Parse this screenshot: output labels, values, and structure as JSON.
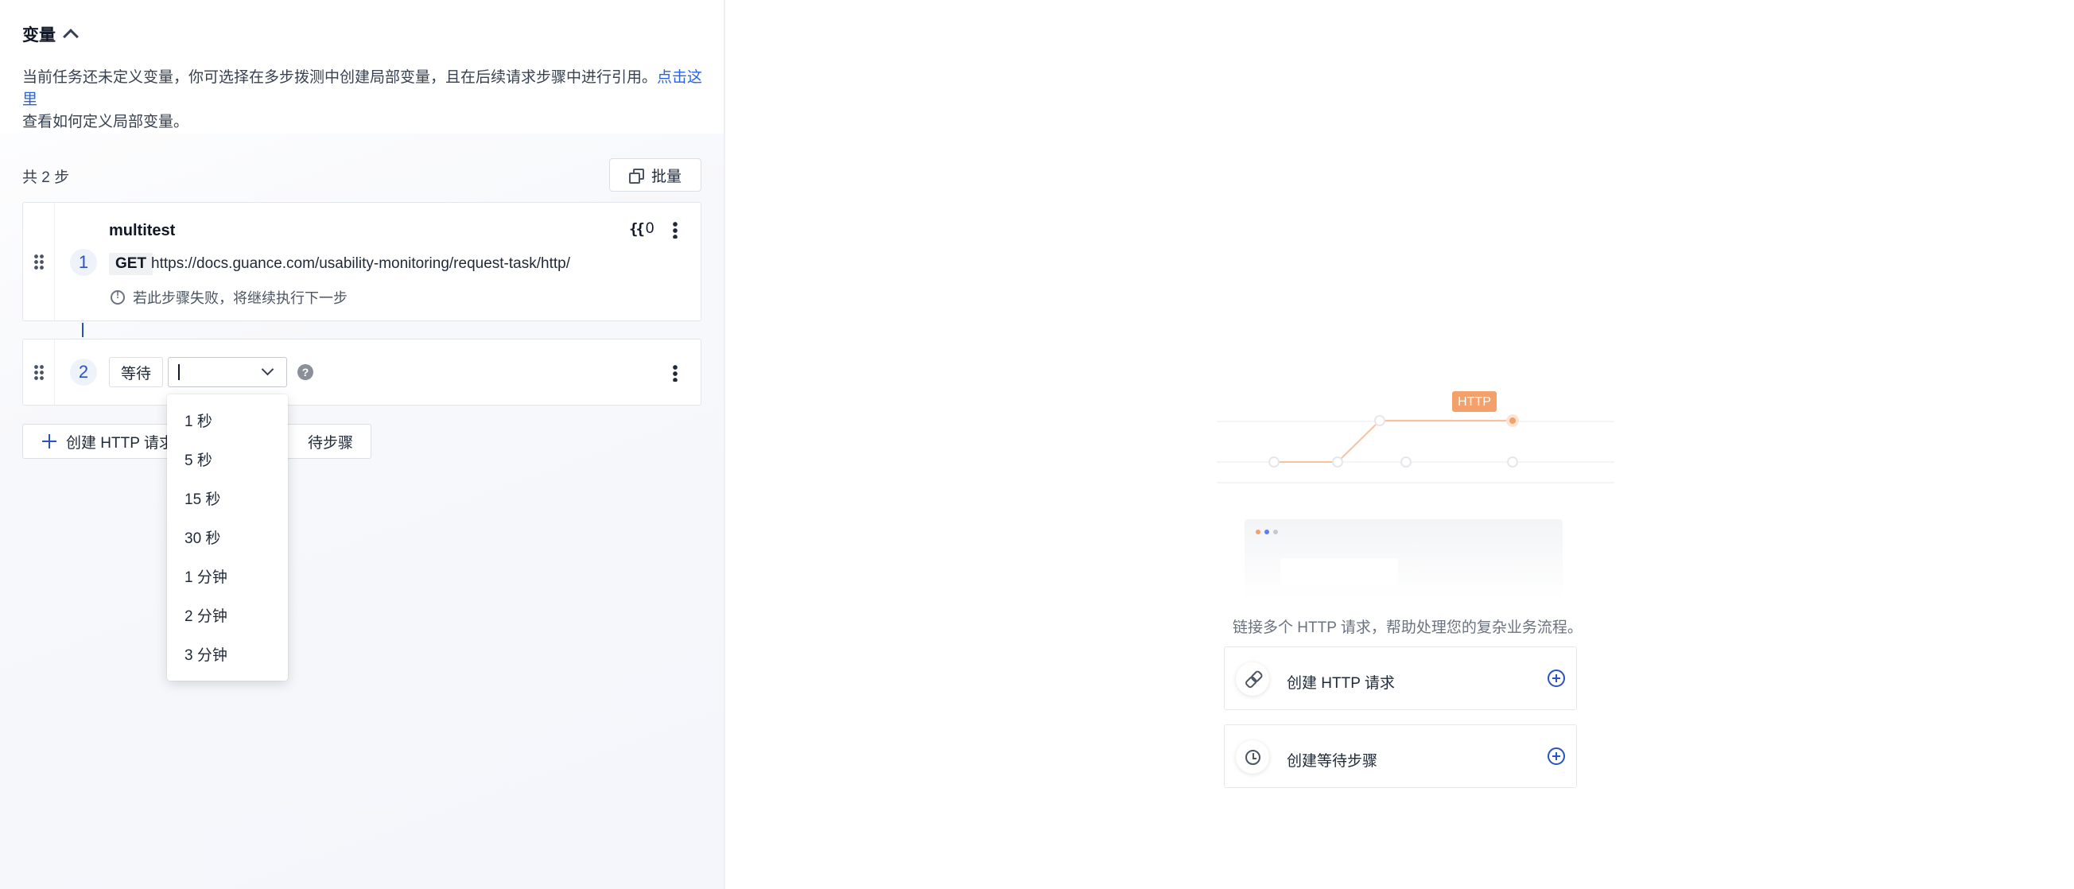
{
  "variables": {
    "title": "变量",
    "description_prefix": "当前任务还未定义变量，你可选择在多步拨测中创建局部变量，且在后续请求步骤中进行引用。",
    "link_text": "点击这里",
    "description_suffix": "查看如何定义局部变量。"
  },
  "steps": {
    "count_label": "共 2 步",
    "batch_label": "批量",
    "step1": {
      "number": "1",
      "name": "multitest",
      "variable_count": "0",
      "method": "GET",
      "url": "https://docs.guance.com/usability-monitoring/request-task/http/",
      "failure_hint": "若此步骤失败，将继续执行下一步"
    },
    "step2": {
      "number": "2",
      "type_label": "等待",
      "selected_value": ""
    },
    "add_http_label": "创建 HTTP 请求",
    "add_wait_label": "待步骤"
  },
  "wait_options": [
    "1 秒",
    "5 秒",
    "15 秒",
    "30 秒",
    "1 分钟",
    "2 分钟",
    "3 分钟"
  ],
  "empty_state": {
    "badge": "HTTP",
    "text": "链接多个 HTTP 请求，帮助处理您的复杂业务流程。",
    "actions": [
      {
        "label": "创建 HTTP 请求",
        "icon": "link-icon"
      },
      {
        "label": "创建等待步骤",
        "icon": "clock-icon"
      }
    ]
  },
  "colors": {
    "accent": "#2952c4",
    "http_badge": "#f4a06a"
  }
}
